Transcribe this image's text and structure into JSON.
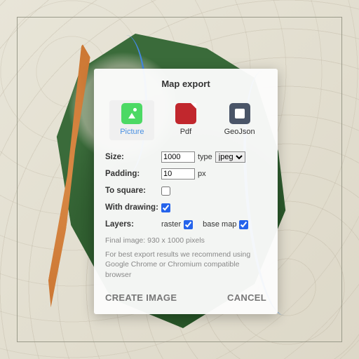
{
  "dialog": {
    "title": "Map export",
    "formats": {
      "picture": "Picture",
      "pdf": "Pdf",
      "geojson": "GeoJson"
    },
    "labels": {
      "size": "Size:",
      "type": "type",
      "padding": "Padding:",
      "px": "px",
      "to_square": "To square:",
      "with_drawing": "With drawing:",
      "layers": "Layers:",
      "raster": "raster",
      "basemap": "base map"
    },
    "values": {
      "size": "1000",
      "imgtype": "jpeg",
      "padding": "10",
      "to_square": false,
      "with_drawing": true,
      "raster": true,
      "basemap": true
    },
    "final_note": "Final image: 930 x 1000 pixels",
    "browser_note": "For best export results we recommend using Google Chrome or Chromium compatible browser",
    "actions": {
      "create": "CREATE IMAGE",
      "cancel": "CANCEL"
    }
  }
}
